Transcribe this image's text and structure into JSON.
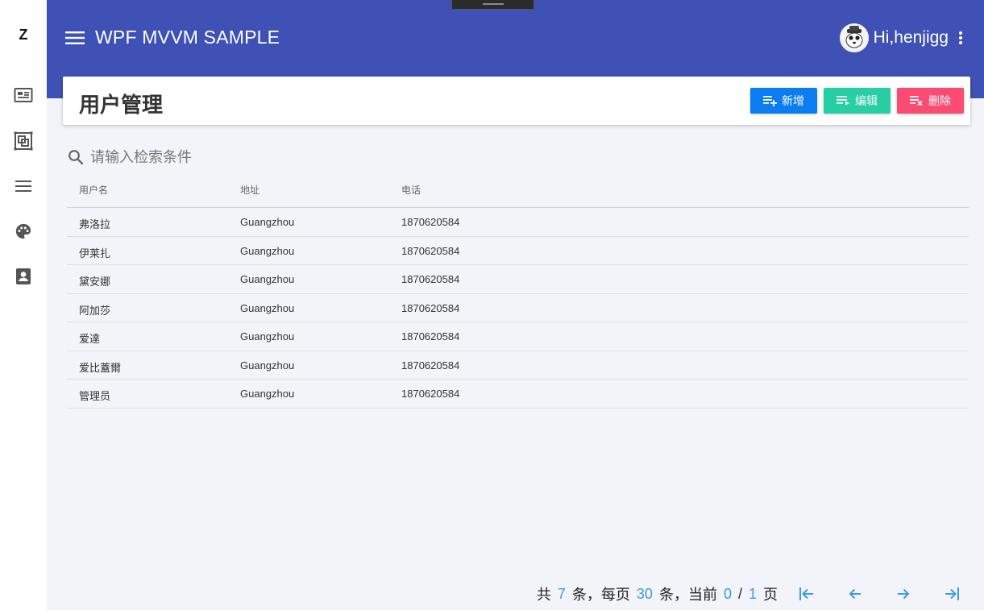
{
  "sidebar": {
    "logo": "Z",
    "items": [
      {
        "icon": "dashboard-icon"
      },
      {
        "icon": "layers-icon"
      },
      {
        "icon": "list-icon"
      },
      {
        "icon": "palette-icon"
      },
      {
        "icon": "contact-icon"
      }
    ]
  },
  "header": {
    "title": "WPF MVVM SAMPLE",
    "greeting": "Hi,henjigg",
    "menu_icon": "hamburger-icon",
    "more_icon": "kebab-icon"
  },
  "card": {
    "title": "用户管理",
    "add_label": "新增",
    "edit_label": "编辑",
    "delete_label": "删除"
  },
  "search": {
    "placeholder": "请输入检索条件",
    "value": ""
  },
  "table": {
    "headers": [
      "用户名",
      "地址",
      "电话"
    ],
    "rows": [
      [
        "弗洛拉",
        "Guangzhou",
        "1870620584"
      ],
      [
        "伊莱扎",
        "Guangzhou",
        "1870620584"
      ],
      [
        "黛安娜",
        "Guangzhou",
        "1870620584"
      ],
      [
        "阿加莎",
        "Guangzhou",
        "1870620584"
      ],
      [
        "爱達",
        "Guangzhou",
        "1870620584"
      ],
      [
        "爱比蓋爾",
        "Guangzhou",
        "1870620584"
      ],
      [
        "管理员",
        "Guangzhou",
        "1870620584"
      ]
    ]
  },
  "pager": {
    "total_prefix": "共",
    "total": "7",
    "total_suffix": "条，每页",
    "page_size": "30",
    "page_size_suffix": "条，当前",
    "current": "0",
    "separator": "/",
    "pages": "1",
    "pages_suffix": "页"
  },
  "colors": {
    "header": "#3f51b5",
    "add": "#0b7cf2",
    "edit": "#29cfa4",
    "delete": "#fb4b72",
    "accent": "#3d9ae8"
  }
}
